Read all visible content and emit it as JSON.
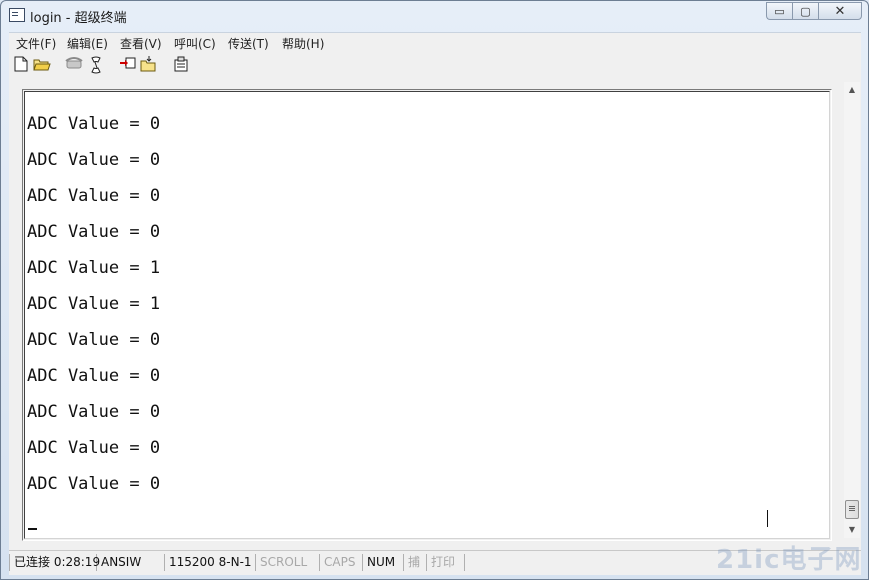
{
  "window": {
    "title": "login - 超级终端"
  },
  "caption_buttons": {
    "minimize": "▭",
    "maximize": "▢",
    "close": "✕"
  },
  "menu": [
    "文件(F)",
    "编辑(E)",
    "查看(V)",
    "呼叫(C)",
    "传送(T)",
    "帮助(H)"
  ],
  "toolbar": {
    "icons": [
      "new-file-icon",
      "open-folder-icon",
      "disconnect-phone-icon",
      "dial-icon",
      "send-file-icon",
      "receive-file-icon",
      "properties-icon"
    ]
  },
  "terminal": {
    "lines": [
      "ADC Value = 0",
      "ADC Value = 0",
      "ADC Value = 0",
      "ADC Value = 0",
      "ADC Value = 1",
      "ADC Value = 1",
      "ADC Value = 0",
      "ADC Value = 0",
      "ADC Value = 0",
      "ADC Value = 0",
      "ADC Value = 0"
    ]
  },
  "status": {
    "connection": "已连接 0:28:19",
    "emulation": "ANSIW",
    "port_settings": "115200 8-N-1",
    "scroll": "SCROLL",
    "caps": "CAPS",
    "num": "NUM",
    "capture": "捕",
    "print": "打印"
  },
  "watermark": "21ic电子网"
}
